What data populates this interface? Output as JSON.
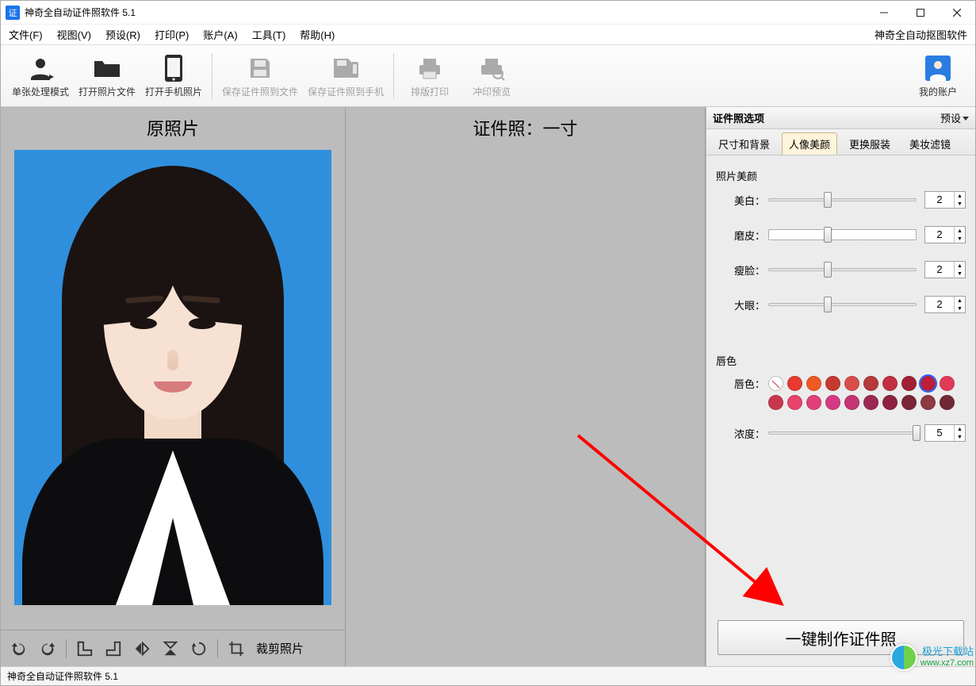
{
  "window": {
    "title": "神奇全自动证件照软件 5.1",
    "icon_text": "证"
  },
  "menus": {
    "file": "文件(F)",
    "view": "视图(V)",
    "preset": "预设(R)",
    "print": "打印(P)",
    "account": "账户(A)",
    "tools": "工具(T)",
    "help": "帮助(H)",
    "right": "神奇全自动抠图软件"
  },
  "toolbar": {
    "mode": "单张处理模式",
    "open_file": "打开照片文件",
    "open_phone": "打开手机照片",
    "save_file": "保存证件照到文件",
    "save_phone": "保存证件照到手机",
    "layout_print": "排版打印",
    "print_preview": "冲印预览",
    "my_account": "我的账户"
  },
  "panes": {
    "left_title": "原照片",
    "middle_title": "证件照：一寸"
  },
  "bottom": {
    "crop_label": "裁剪照片"
  },
  "side": {
    "header": "证件照选项",
    "preset": "预设",
    "tabs": {
      "size_bg": "尺寸和背景",
      "beauty": "人像美颜",
      "clothes": "更换服装",
      "makeup": "美妆滤镜"
    },
    "beauty": {
      "group": "照片美颜",
      "whiten_label": "美白：",
      "whiten_value": "2",
      "smooth_label": "磨皮：",
      "smooth_value": "2",
      "slim_label": "瘦脸：",
      "slim_value": "2",
      "eye_label": "大眼：",
      "eye_value": "2"
    },
    "lip": {
      "group": "唇色",
      "label": "唇色：",
      "colors": [
        "none",
        "#e63b2e",
        "#ef5a24",
        "#c53a2f",
        "#d84e4a",
        "#b43a3b",
        "#c12f41",
        "#a22035",
        "#bc1f3c",
        "#e03a57",
        "#c8374e",
        "#e8436a",
        "#e23f7a",
        "#d63a85",
        "#c53573",
        "#9a2a54",
        "#8d2340",
        "#7a2638",
        "#8d3a42",
        "#6f2a35"
      ],
      "selected_index": 8,
      "density_label": "浓度：",
      "density_value": "5"
    },
    "big_button": "一键制作证件照"
  },
  "status": {
    "text": "神奇全自动证件照软件 5.1"
  },
  "watermark": {
    "l1": "极光下载站",
    "l2": "www.xz7.com"
  }
}
